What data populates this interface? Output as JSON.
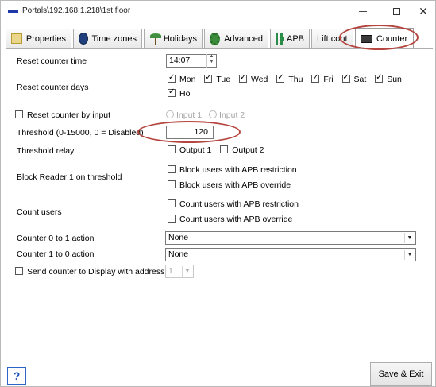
{
  "window": {
    "title": "Portals\\192.168.1.218\\1st floor"
  },
  "tabs": [
    {
      "label": "Properties",
      "icon": "properties-icon"
    },
    {
      "label": "Time zones",
      "icon": "clock-icon"
    },
    {
      "label": "Holidays",
      "icon": "palm-tree-icon"
    },
    {
      "label": "Advanced",
      "icon": "gear-icon"
    },
    {
      "label": "APB",
      "icon": "apb-icon"
    },
    {
      "label": "Lift control",
      "icon": ""
    },
    {
      "label": "Counter",
      "icon": "counter-icon"
    }
  ],
  "active_tab": "Counter",
  "form": {
    "reset_counter_time": {
      "label": "Reset counter time",
      "value": "14:07"
    },
    "reset_counter_days": {
      "label": "Reset counter days",
      "days": [
        {
          "label": "Mon",
          "checked": true
        },
        {
          "label": "Tue",
          "checked": true
        },
        {
          "label": "Wed",
          "checked": true
        },
        {
          "label": "Thu",
          "checked": true
        },
        {
          "label": "Fri",
          "checked": true
        },
        {
          "label": "Sat",
          "checked": true
        },
        {
          "label": "Sun",
          "checked": true
        },
        {
          "label": "Hol",
          "checked": true
        }
      ]
    },
    "reset_by_input": {
      "label": "Reset counter by input",
      "checked": false,
      "input1": "Input 1",
      "input2": "Input 2"
    },
    "threshold": {
      "label": "Threshold (0-15000, 0 = Disabled)",
      "value": "120"
    },
    "threshold_relay": {
      "label": "Threshold relay",
      "output1": "Output 1",
      "output2": "Output 2"
    },
    "block_reader": {
      "label": "Block Reader 1 on threshold",
      "opt1": "Block users with APB restriction",
      "opt2": "Block users with APB override"
    },
    "count_users": {
      "label": "Count users",
      "opt1": "Count users with APB restriction",
      "opt2": "Count users with APB override"
    },
    "counter_0_1": {
      "label": "Counter 0 to 1 action",
      "value": "None"
    },
    "counter_1_0": {
      "label": "Counter 1 to 0 action",
      "value": "None"
    },
    "send_display": {
      "label": "Send counter to Display with address",
      "value": "1"
    }
  },
  "footer": {
    "help_label": "?",
    "save_label": "Save & Exit"
  },
  "colors": {
    "annotation": "#b5453e",
    "title_icon": "#1f3aa8"
  }
}
